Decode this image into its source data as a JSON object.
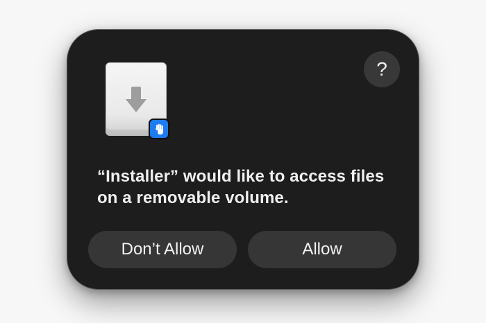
{
  "dialog": {
    "help_label": "?",
    "message": "“Installer” would like to access files on a removable volume.",
    "buttons": {
      "dont_allow": "Don’t Allow",
      "allow": "Allow"
    },
    "icons": {
      "drive": "removable-volume-icon",
      "badge": "privacy-hand-icon",
      "help": "question-mark-icon"
    },
    "colors": {
      "background": "#1d1d1d",
      "button": "#363636",
      "badge": "#1f7cf0"
    }
  }
}
